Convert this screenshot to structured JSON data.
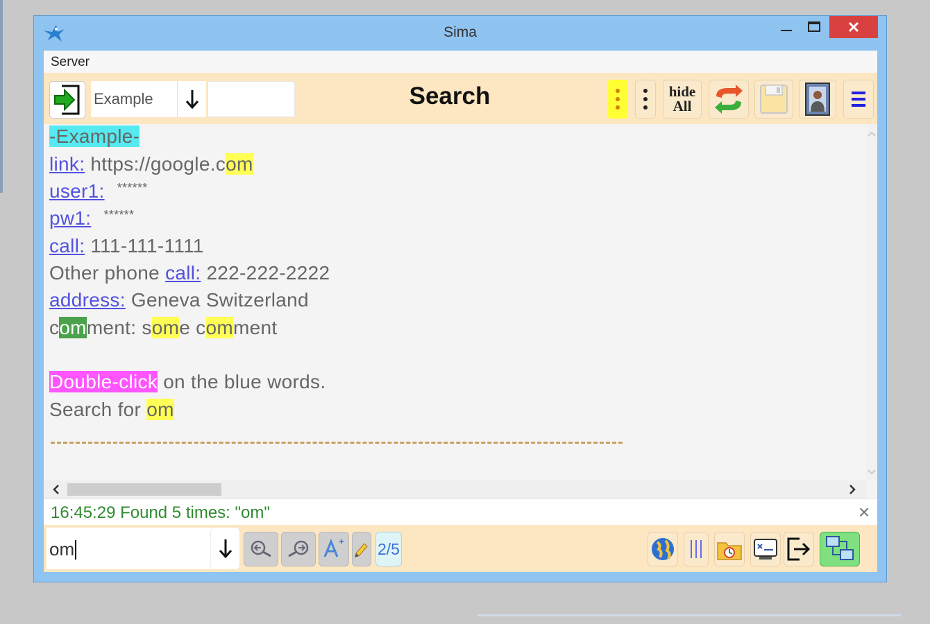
{
  "window": {
    "title": "Sima"
  },
  "menu": {
    "items": [
      "Server"
    ]
  },
  "toolbar": {
    "combo_value": "Example",
    "center_title": "Search",
    "hide_all_line1": "hide",
    "hide_all_line2": "All"
  },
  "content": {
    "heading": "-Example-",
    "link_label": "link:",
    "link_url_pre": " https://google.c",
    "link_url_hl": "om",
    "user1_label": "user1:",
    "user1_value": "******",
    "pw1_label": "pw1:",
    "pw1_value": "******",
    "call_label": "call:",
    "call_value": " 111-111-1111",
    "other_phone_pre": "Other phone ",
    "other_call_label": "call:",
    "other_call_value": " 222-222-2222",
    "address_label": "address:",
    "address_value": " Geneva Switzerland",
    "comment_parts": [
      "c",
      "om",
      "ment: s",
      "om",
      "e c",
      "om",
      "ment"
    ],
    "double_click": "Double-click",
    "double_click_rest": " on the blue words.",
    "search_for_pre": "Search for ",
    "search_for_term": "om"
  },
  "status": {
    "message": "16:45:29  Found 5 times: \"om\"",
    "close_glyph": "×"
  },
  "search": {
    "value": "om",
    "match_counter": "2/5"
  },
  "colors": {
    "toolbar_bg": "#fde6c2",
    "link": "#5151e0",
    "highlight": "#ffff55",
    "current_match": "#4ca24c",
    "heading_bg": "#55eaf0",
    "tip_bg": "#ff55ff",
    "status_text": "#2e8b2e",
    "close_button": "#d94141"
  },
  "icons": [
    "bird-icon",
    "login-icon",
    "arrow-down-icon",
    "more-yellow-icon",
    "more-icon",
    "sync-icon",
    "save-icon",
    "contacts-icon",
    "menu-icon",
    "search-prev-icon",
    "search-next-icon",
    "font-size-icon",
    "pencil-icon",
    "globe-icon",
    "columns-icon",
    "backup-icon",
    "terminal-icon",
    "exit-icon",
    "network-icon"
  ]
}
